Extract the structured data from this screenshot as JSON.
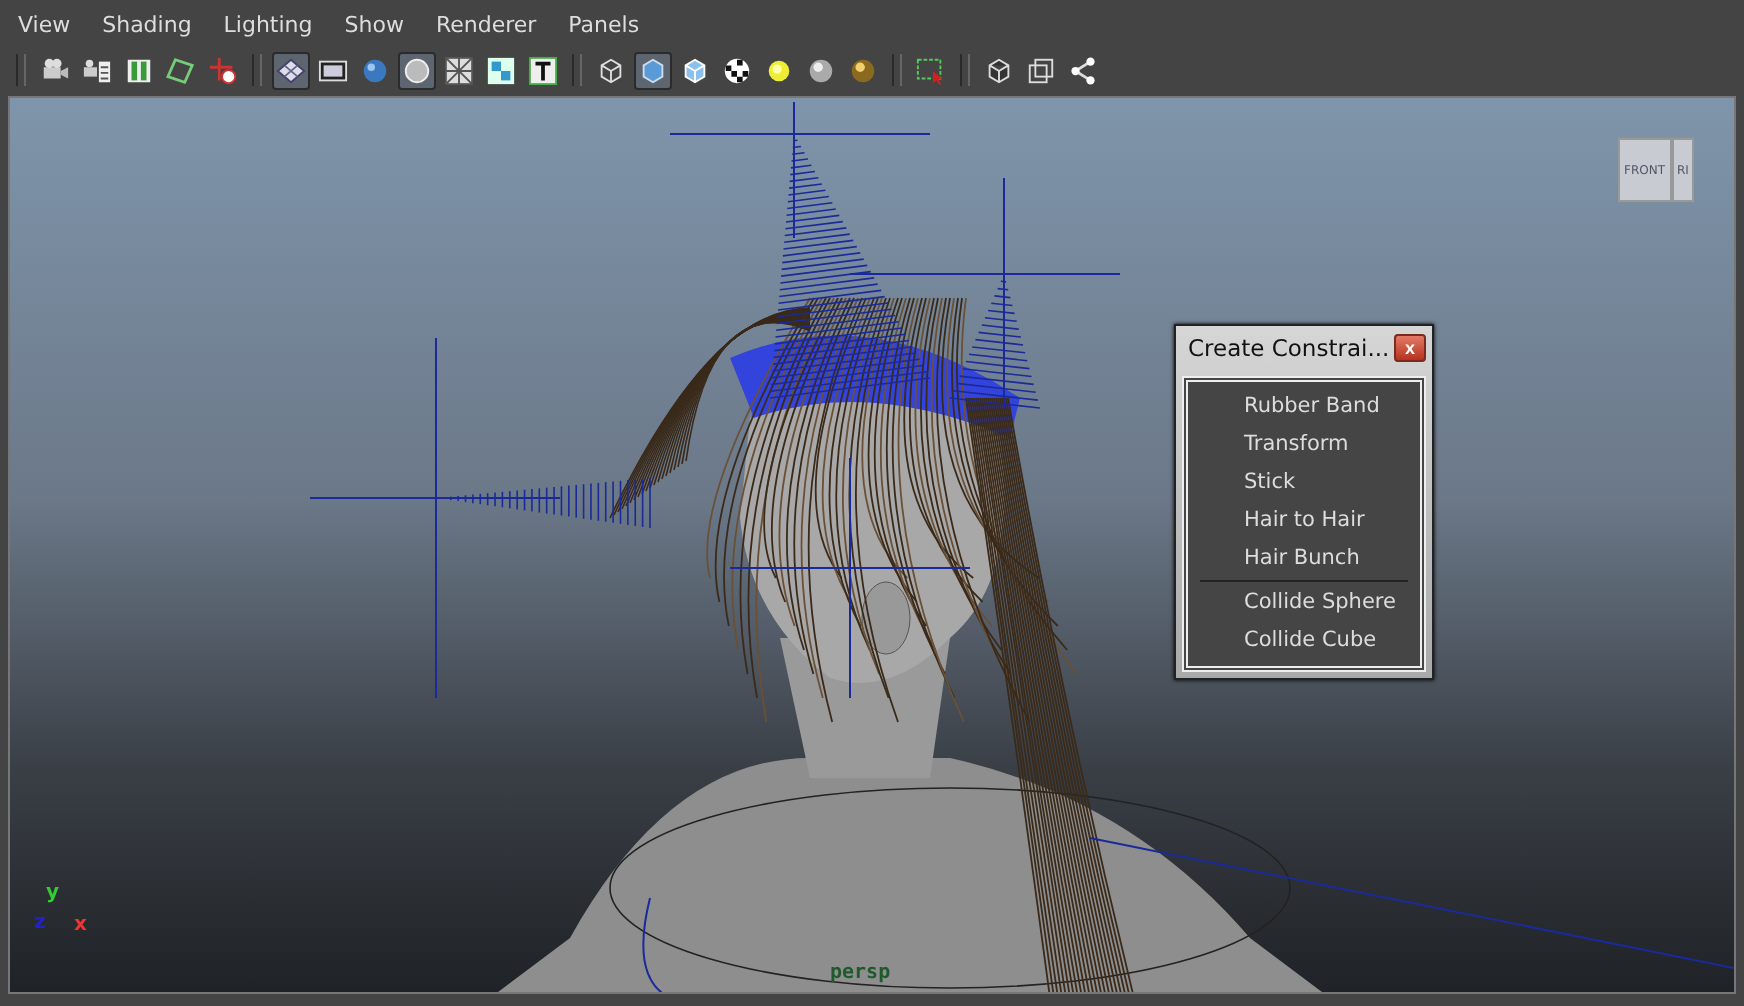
{
  "menu_bar": {
    "items": [
      "View",
      "Shading",
      "Lighting",
      "Show",
      "Renderer",
      "Panels"
    ]
  },
  "toolbar": {
    "groups": [
      [
        {
          "kind": "camera",
          "selected": false
        },
        {
          "kind": "camera-attributes",
          "selected": false
        },
        {
          "kind": "bookmark",
          "selected": false
        },
        {
          "kind": "image-plane",
          "selected": false
        },
        {
          "kind": "grid-points",
          "selected": false
        }
      ],
      [
        {
          "kind": "wireframe",
          "selected": true
        },
        {
          "kind": "film-gate",
          "selected": false
        },
        {
          "kind": "sphere",
          "selected": false
        },
        {
          "kind": "circle",
          "selected": true
        },
        {
          "kind": "grid-x",
          "selected": false
        },
        {
          "kind": "nodes",
          "selected": false
        },
        {
          "kind": "text-tool",
          "selected": false
        }
      ],
      [
        {
          "kind": "wire-cube",
          "selected": false
        },
        {
          "kind": "shaded-cube",
          "selected": true
        },
        {
          "kind": "cube",
          "selected": false
        },
        {
          "kind": "checker",
          "selected": false
        },
        {
          "kind": "light",
          "selected": false
        },
        {
          "kind": "grey-sphere",
          "selected": false
        },
        {
          "kind": "gold-sphere",
          "selected": false
        }
      ],
      [
        {
          "kind": "select-box",
          "selected": false
        }
      ],
      [
        {
          "kind": "iso-cube",
          "selected": false
        },
        {
          "kind": "squares",
          "selected": false
        },
        {
          "kind": "share",
          "selected": false
        }
      ]
    ]
  },
  "viewport": {
    "view_cube": {
      "front": "FRONT",
      "side": "RI"
    },
    "camera": "persp",
    "axes": {
      "y": "y",
      "z": "z",
      "x": "x"
    }
  },
  "dialog": {
    "title": "Create Constrai...",
    "close": "x",
    "groups": [
      [
        "Rubber Band",
        "Transform",
        "Stick",
        "Hair to Hair",
        "Hair Bunch"
      ],
      [
        "Collide Sphere",
        "Collide Cube"
      ]
    ]
  }
}
